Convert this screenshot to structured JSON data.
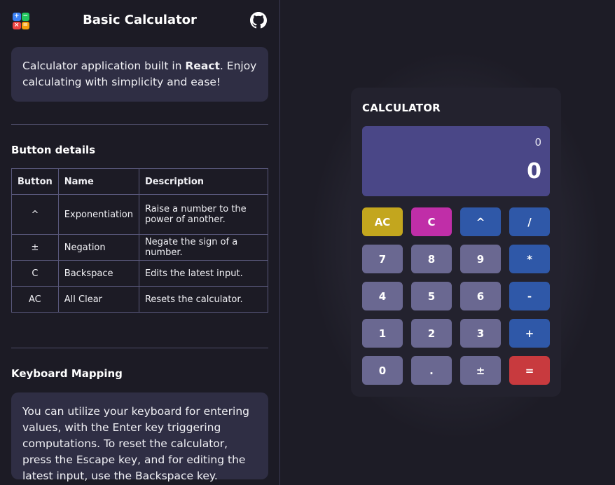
{
  "app": {
    "title": "Basic Calculator",
    "logo_glyphs": [
      "+",
      "−",
      "×",
      "="
    ],
    "github_icon": "github-icon"
  },
  "intro": {
    "text_before": "Calculator application built in ",
    "text_bold": "React",
    "text_after": ". Enjoy calculating with simplicity and ease!"
  },
  "button_details": {
    "title": "Button details",
    "headers": [
      "Button",
      "Name",
      "Description"
    ],
    "rows": [
      {
        "button": "^",
        "name": "Exponentiation",
        "description": "Raise a number to the power of another."
      },
      {
        "button": "±",
        "name": "Negation",
        "description": "Negate the sign of a number."
      },
      {
        "button": "C",
        "name": "Backspace",
        "description": "Edits the latest input."
      },
      {
        "button": "AC",
        "name": "All Clear",
        "description": "Resets the calculator."
      }
    ]
  },
  "keyboard": {
    "title": "Keyboard Mapping",
    "text": "You can utilize your keyboard for entering values, with the Enter key triggering computations. To reset the calculator, press the Escape key, and for editing the latest input, use the Backspace key."
  },
  "calculator": {
    "title": "CALCULATOR",
    "previous": "0",
    "current": "0",
    "keys": [
      {
        "label": "AC",
        "kind": "ac",
        "name": "all-clear"
      },
      {
        "label": "C",
        "kind": "c",
        "name": "backspace"
      },
      {
        "label": "^",
        "kind": "op",
        "name": "exponent"
      },
      {
        "label": "/",
        "kind": "op",
        "name": "divide"
      },
      {
        "label": "7",
        "kind": "num",
        "name": "7"
      },
      {
        "label": "8",
        "kind": "num",
        "name": "8"
      },
      {
        "label": "9",
        "kind": "num",
        "name": "9"
      },
      {
        "label": "*",
        "kind": "op",
        "name": "multiply"
      },
      {
        "label": "4",
        "kind": "num",
        "name": "4"
      },
      {
        "label": "5",
        "kind": "num",
        "name": "5"
      },
      {
        "label": "6",
        "kind": "num",
        "name": "6"
      },
      {
        "label": "-",
        "kind": "op",
        "name": "subtract"
      },
      {
        "label": "1",
        "kind": "num",
        "name": "1"
      },
      {
        "label": "2",
        "kind": "num",
        "name": "2"
      },
      {
        "label": "3",
        "kind": "num",
        "name": "3"
      },
      {
        "label": "+",
        "kind": "op",
        "name": "add"
      },
      {
        "label": "0",
        "kind": "num",
        "name": "0"
      },
      {
        "label": ".",
        "kind": "num",
        "name": "decimal"
      },
      {
        "label": "±",
        "kind": "num",
        "name": "negate"
      },
      {
        "label": "=",
        "kind": "eq",
        "name": "equals"
      }
    ]
  },
  "colors": {
    "background": "#1d1c26",
    "card": "#2f2e44",
    "display": "#4a4787",
    "number_key": "#6a6891",
    "operator_key": "#2f58a8",
    "ac_key": "#c3a61e",
    "c_key": "#c02ea8",
    "equals_key": "#c83a3e"
  }
}
